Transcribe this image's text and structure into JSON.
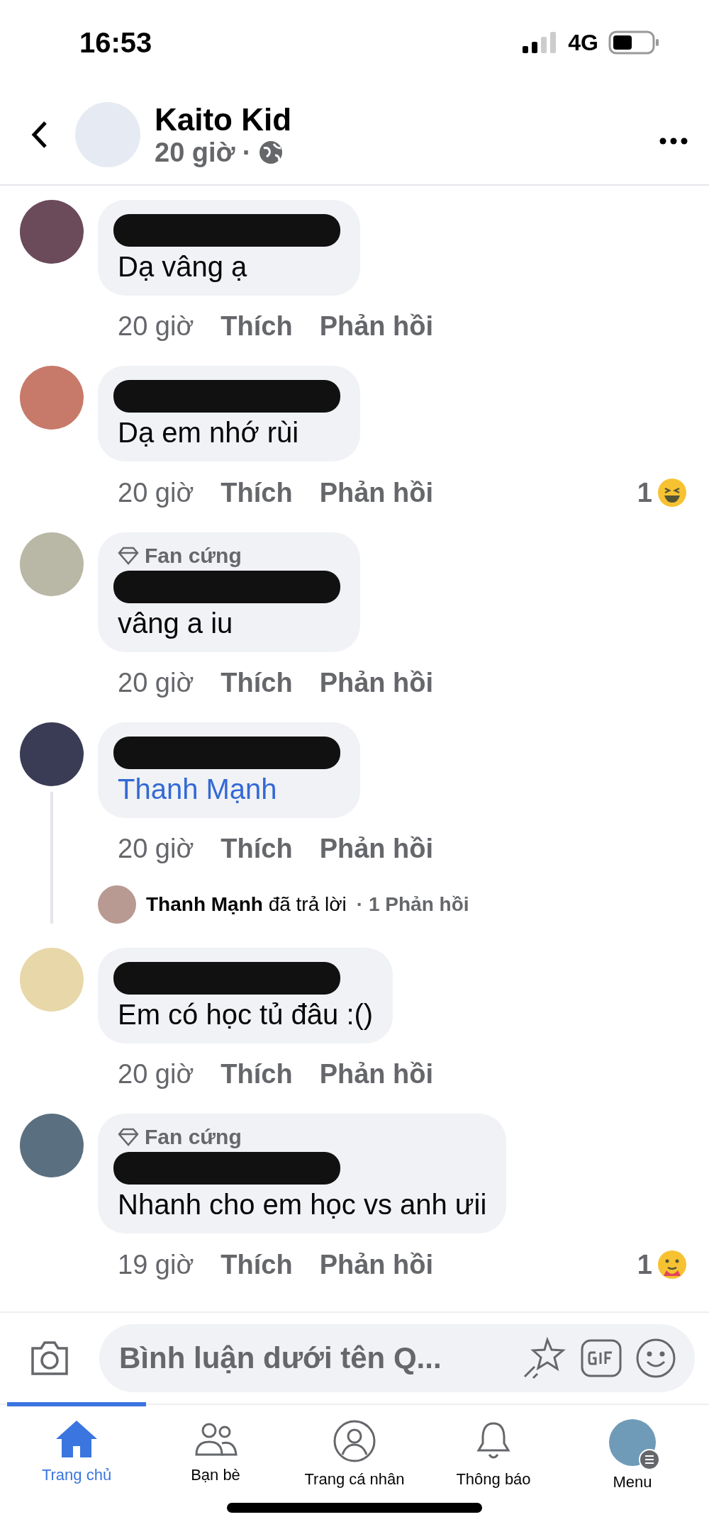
{
  "status_bar": {
    "time": "16:53",
    "network": "4G"
  },
  "header": {
    "title": "Kaito Kid",
    "time": "20 giờ",
    "separator": "·"
  },
  "comments": [
    {
      "text": "Dạ vâng ạ",
      "kind": "text",
      "time": "20 giờ",
      "like": "Thích",
      "reply": "Phản hồi"
    },
    {
      "text": "Dạ em nhớ rùi",
      "kind": "text",
      "time": "20 giờ",
      "like": "Thích",
      "reply": "Phản hồi",
      "reaction": {
        "count": "1",
        "kind": "haha"
      }
    },
    {
      "badge": "Fan cứng",
      "text": "vâng a iu",
      "kind": "text",
      "time": "20 giờ",
      "like": "Thích",
      "reply": "Phản hồi"
    },
    {
      "text": "Thanh Mạnh",
      "kind": "mention",
      "time": "20 giờ",
      "like": "Thích",
      "reply": "Phản hồi",
      "replies": {
        "name": "Thanh Mạnh",
        "action": "đã trả lời",
        "count": "· 1 Phản hồi"
      }
    },
    {
      "text": "Em có học tủ đâu :()",
      "kind": "text",
      "time": "20 giờ",
      "like": "Thích",
      "reply": "Phản hồi"
    },
    {
      "badge": "Fan cứng",
      "text": "Nhanh cho em học vs anh ưii",
      "kind": "text",
      "time": "19 giờ",
      "like": "Thích",
      "reply": "Phản hồi",
      "reaction": {
        "count": "1",
        "kind": "care"
      }
    }
  ],
  "composer": {
    "placeholder": "Bình luận dưới tên Q..."
  },
  "nav": [
    {
      "label": "Trang chủ",
      "selected": true
    },
    {
      "label": "Bạn bè",
      "selected": false
    },
    {
      "label": "Trang cá nhân",
      "selected": false
    },
    {
      "label": "Thông báo",
      "selected": false
    },
    {
      "label": "Menu",
      "selected": false
    }
  ]
}
